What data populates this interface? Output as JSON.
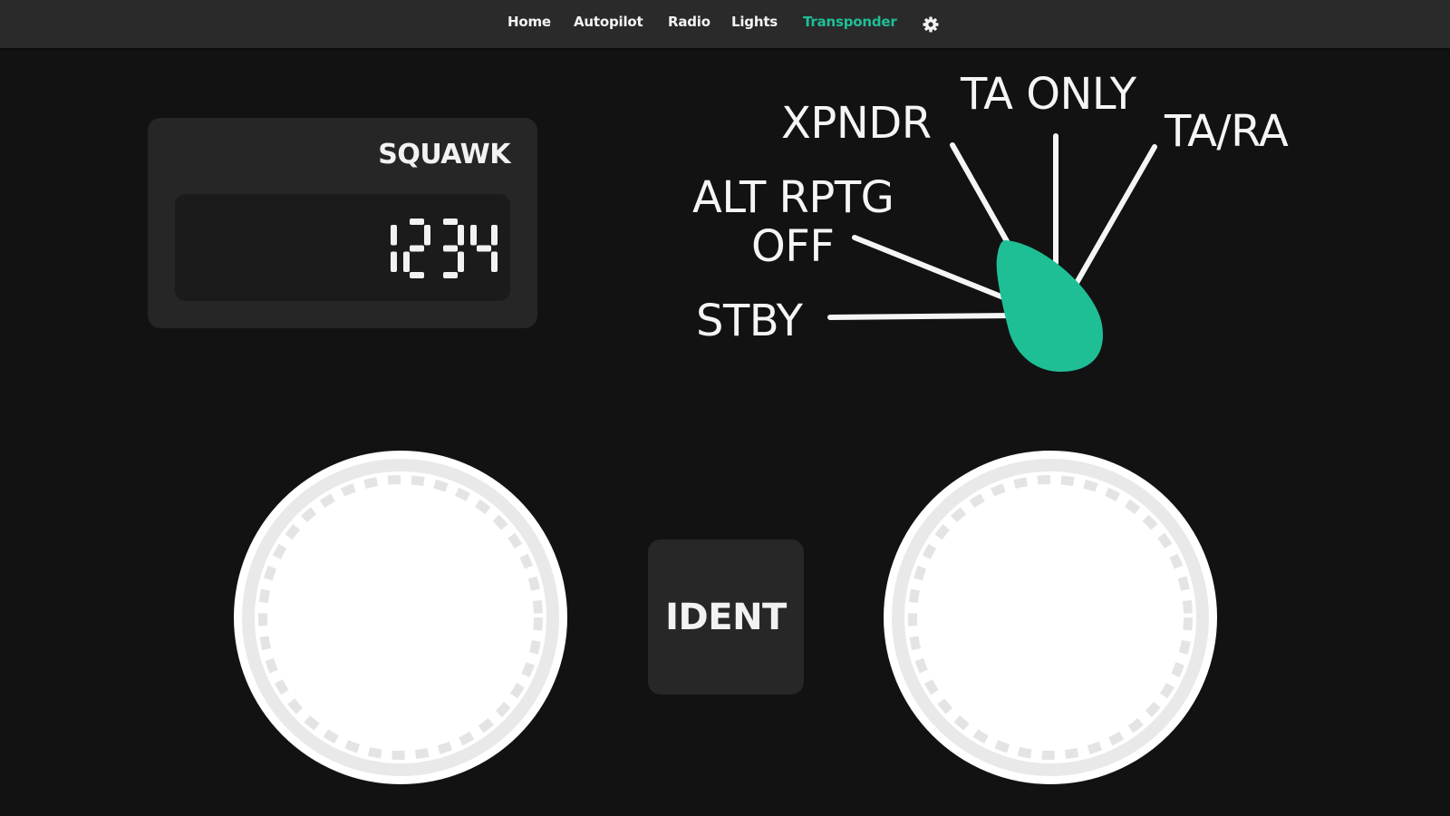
{
  "nav": {
    "items": [
      {
        "label": "Home",
        "active": false
      },
      {
        "label": "Autopilot",
        "active": false
      },
      {
        "label": "Radio",
        "active": false
      },
      {
        "label": "Lights",
        "active": false
      },
      {
        "label": "Transponder",
        "active": true
      }
    ],
    "settings_icon": "gear-icon"
  },
  "squawk": {
    "label": "SQUAWK",
    "code": "1234"
  },
  "mode_selector": {
    "positions": [
      "STBY",
      "ALT RPTG OFF",
      "XPNDR",
      "TA ONLY",
      "TA/RA"
    ],
    "labels": {
      "stby": "STBY",
      "alt_rptg": "ALT RPTG",
      "off": "OFF",
      "xpndr": "XPNDR",
      "ta_only": "TA ONLY",
      "ta_ra": "TA/RA"
    },
    "selected": "STBY"
  },
  "ident": {
    "label": "IDENT"
  },
  "colors": {
    "accent": "#1fbf95",
    "background": "#121212",
    "navbar": "#2a2a2a",
    "panel": "#262626",
    "text": "#f2f2f2",
    "knob": "#ffffff",
    "knob_ring": "#e6e6e6"
  }
}
